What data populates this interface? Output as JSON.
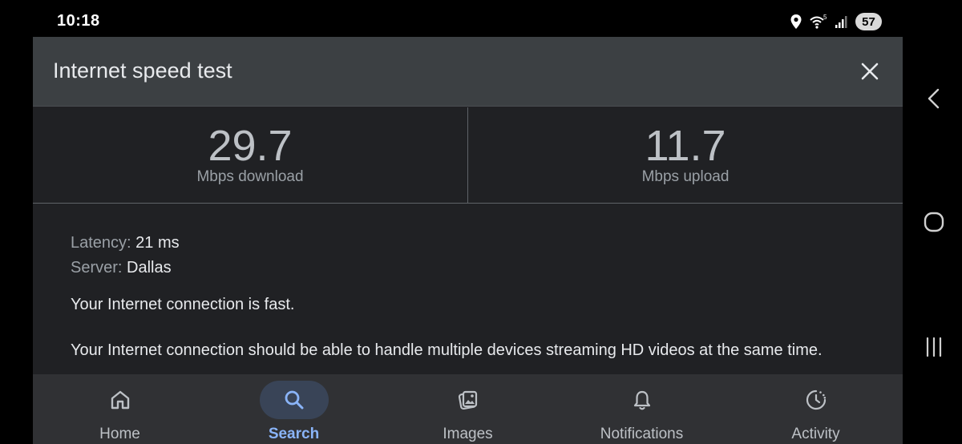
{
  "status_bar": {
    "time": "10:18",
    "icons": [
      "location-icon",
      "wifi-icon",
      "signal-icon"
    ],
    "battery": "57"
  },
  "speed_test": {
    "title": "Internet speed test",
    "download": {
      "value": "29.7",
      "label": "Mbps download"
    },
    "upload": {
      "value": "11.7",
      "label": "Mbps upload"
    },
    "latency": {
      "key": "Latency:",
      "value": "21 ms"
    },
    "server": {
      "key": "Server:",
      "value": "Dallas"
    },
    "summary": "Your Internet connection is fast.",
    "description": "Your Internet connection should be able to handle multiple devices streaming HD videos at the same time."
  },
  "bottom_nav": {
    "items": [
      {
        "label": "Home",
        "icon": "home-icon"
      },
      {
        "label": "Search",
        "icon": "search-icon",
        "active": true
      },
      {
        "label": "Images",
        "icon": "images-icon"
      },
      {
        "label": "Notifications",
        "icon": "bell-icon"
      },
      {
        "label": "Activity",
        "icon": "activity-icon"
      }
    ]
  },
  "colors": {
    "background": "#202124",
    "header": "#3c4043",
    "accent": "#8ab4f8",
    "active_pill": "#394457",
    "nav_bar": "#303134"
  }
}
